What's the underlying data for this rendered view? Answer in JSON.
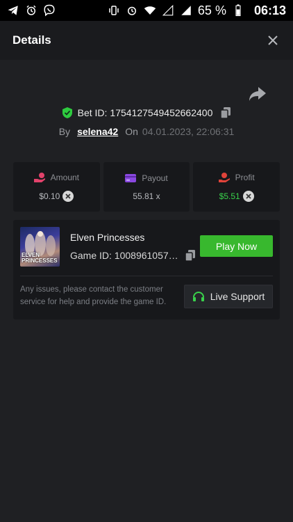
{
  "status_bar": {
    "battery": "65 %",
    "time": "06:13"
  },
  "header": {
    "title": "Details",
    "close_symbol": "✕"
  },
  "bet": {
    "label": "Bet ID:",
    "id": "1754127549452662400",
    "by_label": "By",
    "username": "selena42",
    "on_label": "On",
    "datetime": "04.01.2023, 22:06:31"
  },
  "stats": {
    "amount": {
      "label": "Amount",
      "value": "$0.10"
    },
    "payout": {
      "label": "Payout",
      "value": "55.81 x"
    },
    "profit": {
      "label": "Profit",
      "value": "$5.51"
    }
  },
  "game": {
    "name": "Elven Princesses",
    "id_label": "Game ID: 1008961057…",
    "thumb_text_top": "ELVEN",
    "thumb_text_bottom": "PRINCESSES",
    "play_label": "Play Now"
  },
  "support": {
    "message": "Any issues, please contact the customer service for help and provide the game ID.",
    "button_label": "Live Support"
  },
  "colors": {
    "accent_green": "#38b82e",
    "profit_green": "#39d14b",
    "shield_green": "#2ecb3f"
  }
}
